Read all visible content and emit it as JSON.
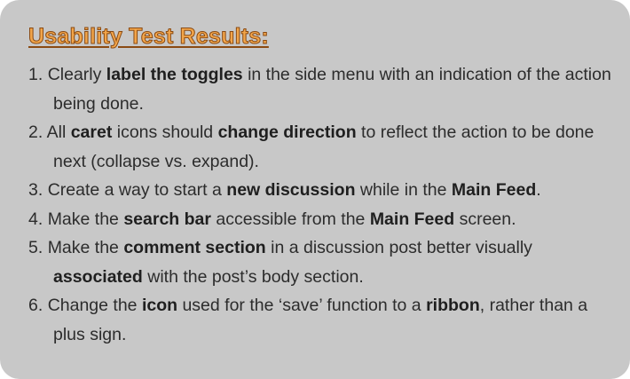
{
  "title": "Usability Test Results:",
  "items": [
    {
      "number": "1.",
      "segments": [
        {
          "text": "Clearly ",
          "bold": false
        },
        {
          "text": "label the toggles",
          "bold": true
        },
        {
          "text": " in the side menu with an indication of the action being done.",
          "bold": false
        }
      ]
    },
    {
      "number": "2.",
      "segments": [
        {
          "text": "All ",
          "bold": false
        },
        {
          "text": "caret",
          "bold": true
        },
        {
          "text": " icons should ",
          "bold": false
        },
        {
          "text": "change direction",
          "bold": true
        },
        {
          "text": " to reflect the action to be done next (collapse vs. expand).",
          "bold": false
        }
      ]
    },
    {
      "number": "3.",
      "segments": [
        {
          "text": "Create a way to start a ",
          "bold": false
        },
        {
          "text": "new discussion",
          "bold": true
        },
        {
          "text": " while in the ",
          "bold": false
        },
        {
          "text": "Main Feed",
          "bold": true
        },
        {
          "text": ".",
          "bold": false
        }
      ]
    },
    {
      "number": "4.",
      "segments": [
        {
          "text": "Make the ",
          "bold": false
        },
        {
          "text": "search bar",
          "bold": true
        },
        {
          "text": " accessible from the ",
          "bold": false
        },
        {
          "text": "Main Feed",
          "bold": true
        },
        {
          "text": " screen.",
          "bold": false
        }
      ]
    },
    {
      "number": "5.",
      "segments": [
        {
          "text": "Make the ",
          "bold": false
        },
        {
          "text": "comment section",
          "bold": true
        },
        {
          "text": " in a discussion post better visually ",
          "bold": false
        },
        {
          "text": "associated",
          "bold": true
        },
        {
          "text": " with the post’s body section.",
          "bold": false
        }
      ]
    },
    {
      "number": "6.",
      "segments": [
        {
          "text": "Change the ",
          "bold": false
        },
        {
          "text": "icon",
          "bold": true
        },
        {
          "text": " used for the ‘save’ function to a ",
          "bold": false
        },
        {
          "text": "ribbon",
          "bold": true
        },
        {
          "text": ", rather than a plus sign.",
          "bold": false
        }
      ]
    }
  ]
}
